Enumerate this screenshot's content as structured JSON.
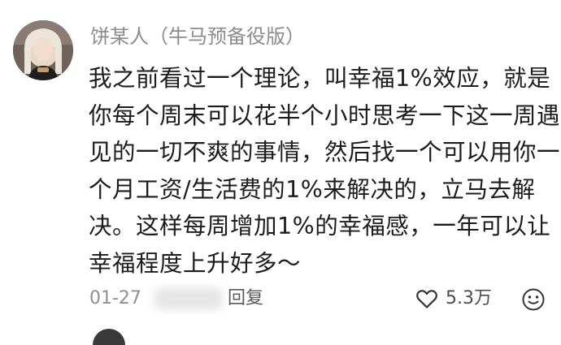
{
  "comment": {
    "username": "饼某人（牛马预备役版）",
    "body_lines": [
      "我之前看过一个理论，叫幸福1%效应，就是",
      "你每个周末可以花半个小时思考一下这一周遇",
      "见的一切不爽的事情，然后找一个可以用你一",
      "个月工资/生活费的1%来解决的，立马去解",
      "决。这样每周增加1%的幸福感，一年可以让",
      "幸福程度上升好多～"
    ],
    "date": "01-27",
    "reply_label": "回复",
    "like_count": "5.3万",
    "icons": {
      "like": "heart-outline-icon",
      "reaction": "emoji-face-icon"
    }
  }
}
